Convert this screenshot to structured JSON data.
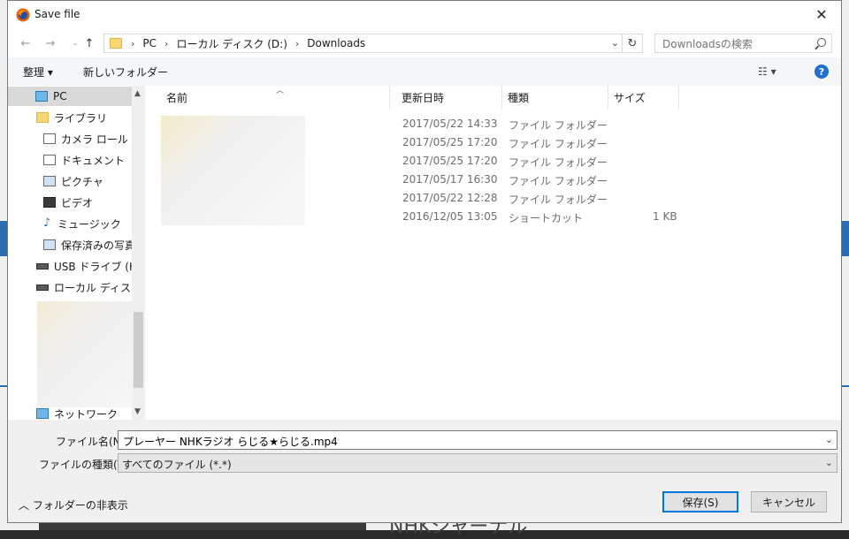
{
  "window": {
    "title": "Save file",
    "close_glyph": "✕"
  },
  "address": {
    "crumbs": [
      "PC",
      "ローカル ディスク (D:)",
      "Downloads"
    ],
    "search_placeholder": "Downloadsの検索"
  },
  "toolbar": {
    "organize_label": "整理 ▾",
    "new_folder_label": "新しいフォルダー",
    "view_glyph": "☷ ▾",
    "help_glyph": "?"
  },
  "nav": {
    "items": [
      {
        "label": "PC",
        "icon": "pc-icon"
      },
      {
        "label": "ライブラリ",
        "icon": "library-icon"
      },
      {
        "label": "カメラ ロール",
        "icon": "camera-roll-icon"
      },
      {
        "label": "ドキュメント",
        "icon": "document-icon"
      },
      {
        "label": "ピクチャ",
        "icon": "picture-icon"
      },
      {
        "label": "ビデオ",
        "icon": "video-icon"
      },
      {
        "label": "ミュージック",
        "icon": "music-icon"
      },
      {
        "label": "保存済みの写真",
        "icon": "saved-pictures-icon"
      },
      {
        "label": "USB ドライブ (H:)",
        "icon": "usb-drive-icon"
      },
      {
        "label": "ローカル ディスク (G",
        "icon": "local-disk-icon"
      },
      {
        "label": "ネットワーク",
        "icon": "network-icon"
      }
    ]
  },
  "columns": {
    "name": "名前",
    "modified": "更新日時",
    "type": "種類",
    "size": "サイズ"
  },
  "rows": [
    {
      "date": "2017/05/22 14:33",
      "type": "ファイル フォルダー",
      "size": ""
    },
    {
      "date": "2017/05/25 17:20",
      "type": "ファイル フォルダー",
      "size": ""
    },
    {
      "date": "2017/05/25 17:20",
      "type": "ファイル フォルダー",
      "size": ""
    },
    {
      "date": "2017/05/17 16:30",
      "type": "ファイル フォルダー",
      "size": ""
    },
    {
      "date": "2017/05/22 12:28",
      "type": "ファイル フォルダー",
      "size": ""
    },
    {
      "date": "2016/12/05 13:05",
      "type": "ショートカット",
      "size": "1 KB"
    }
  ],
  "form": {
    "filename_label": "ファイル名(N):",
    "filename_value": "プレーヤー NHKラジオ らじる★らじる.mp4",
    "filetype_label": "ファイルの種類(T):",
    "filetype_value": "すべてのファイル (*.*)",
    "hide_folders_label": "フォルダーの非表示",
    "save_label": "保存(S)",
    "cancel_label": "キャンセル"
  },
  "background": {
    "text": "NHKジャーナル"
  },
  "colors": {
    "accent": "#0078d7",
    "help": "#1e6fcf",
    "selection": "#d9d9d9"
  }
}
